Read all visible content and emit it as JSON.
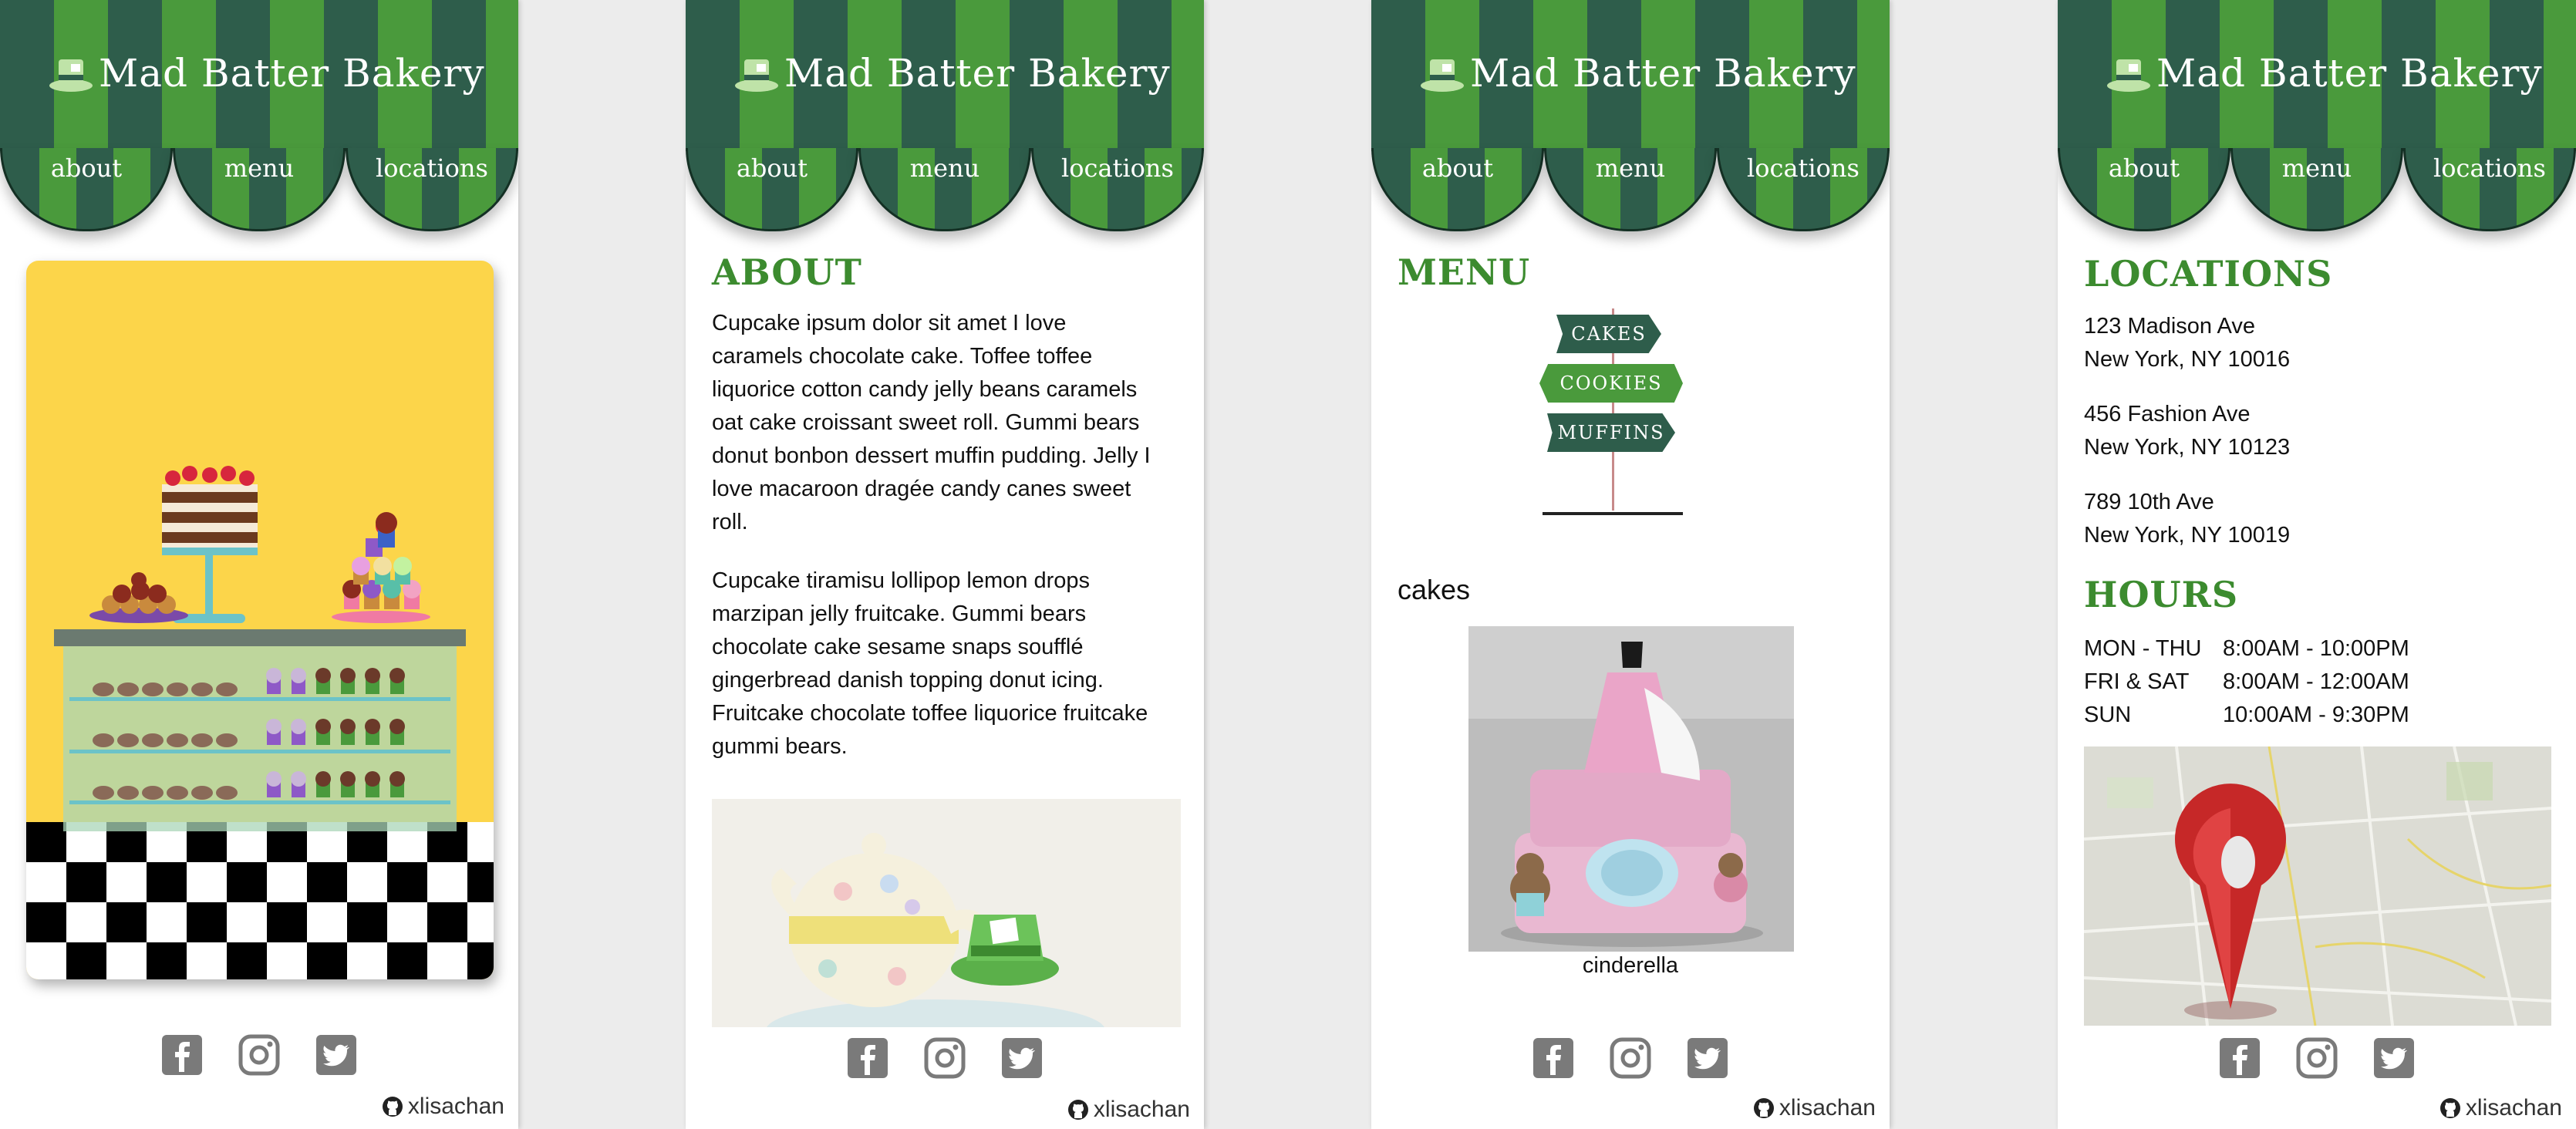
{
  "brand": {
    "name": "Mad Batter Bakery"
  },
  "nav": {
    "about": "about",
    "menu": "menu",
    "locations": "locations"
  },
  "footer": {
    "credit": "xlisachan",
    "social": [
      "facebook-icon",
      "instagram-icon",
      "twitter-icon"
    ]
  },
  "about": {
    "heading": "ABOUT",
    "p1": "Cupcake ipsum dolor sit amet I love caramels chocolate cake. Toffee toffee liquorice cotton candy jelly beans caramels oat cake croissant sweet roll. Gummi bears donut bonbon dessert muffin pudding. Jelly I love macaroon dragée candy canes sweet roll.",
    "p2": "Cupcake tiramisu lollipop lemon drops marzipan jelly fruitcake. Gummi bears chocolate cake sesame snaps soufflé gingerbread danish topping donut icing. Fruitcake chocolate toffee liquorice fruitcake gummi bears."
  },
  "menu": {
    "heading": "MENU",
    "signs": [
      "CAKES",
      "COOKIES",
      "MUFFINS"
    ],
    "section": "cakes",
    "caption": "cinderella"
  },
  "locations": {
    "heading": "LOCATIONS",
    "addresses": [
      {
        "street": "123 Madison Ave",
        "city": "New York, NY 10016"
      },
      {
        "street": "456 Fashion Ave",
        "city": "New York, NY 10123"
      },
      {
        "street": "789 10th Ave",
        "city": "New York, NY 10019"
      }
    ],
    "hours_heading": "HOURS",
    "hours": [
      {
        "day": "MON - THU",
        "time": "8:00AM - 10:00PM"
      },
      {
        "day": "FRI & SAT",
        "time": "8:00AM - 12:00AM"
      },
      {
        "day": "SUN",
        "time": "10:00AM - 9:30PM"
      }
    ]
  },
  "colors": {
    "dark_green": "#2e5d4b",
    "light_green": "#4a9a3c",
    "heading_green": "#3c8b2f",
    "hero_yellow": "#fcd54a"
  }
}
